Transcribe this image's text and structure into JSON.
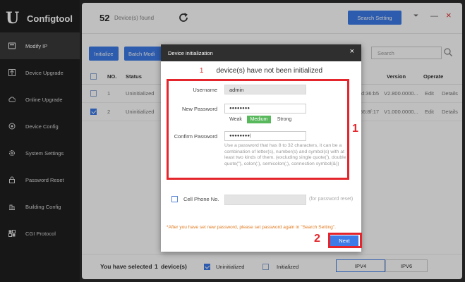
{
  "app": {
    "name": "Configtool",
    "logo_glyph": "U",
    "accent_color": "#3d7be8"
  },
  "sidebar": {
    "items": [
      {
        "label": "Modify IP",
        "icon": "modify-ip-icon",
        "active": true
      },
      {
        "label": "Device Upgrade",
        "icon": "upgrade-icon"
      },
      {
        "label": "Online Upgrade",
        "icon": "cloud-icon"
      },
      {
        "label": "Device Config",
        "icon": "config-icon"
      },
      {
        "label": "System Settings",
        "icon": "gear-icon"
      },
      {
        "label": "Password Reset",
        "icon": "lock-icon"
      },
      {
        "label": "Building Config",
        "icon": "building-icon"
      },
      {
        "label": "CGI Protocol",
        "icon": "protocol-icon"
      }
    ]
  },
  "header": {
    "count": "52",
    "count_label": "Device(s) found",
    "search_setting": "Search Setting",
    "minimize": "—",
    "close": "×",
    "pin": "⏷"
  },
  "toolbar": {
    "initialize": "Initialize",
    "batch_modify": "Batch Modi",
    "search_placeholder": "Search"
  },
  "table": {
    "headers": {
      "no": "NO.",
      "status": "Status",
      "version": "Version",
      "operate": "Operate"
    },
    "rows": [
      {
        "no": "1",
        "status": "Uninitialized",
        "mac_tail": "d:36:b5",
        "version": "V2.800.0000...",
        "edit": "Edit",
        "details": "Details",
        "checked": false
      },
      {
        "no": "2",
        "status": "Uninitialized",
        "mac_tail": "56:8f:17",
        "version": "V1.000.0000...",
        "edit": "Edit",
        "details": "Details",
        "checked": true
      }
    ]
  },
  "footer": {
    "selected_prefix": "You have selected",
    "selected_count": "1",
    "selected_suffix": "device(s)",
    "uninitialized": "Uninitialized",
    "initialized": "Initialized",
    "ipv4": "IPV4",
    "ipv6": "IPV6"
  },
  "dialog": {
    "title": "Device initialization",
    "close": "×",
    "uninit_count": "1",
    "uninit_text": "device(s) have not been initialized",
    "username_label": "Username",
    "username_value": "admin",
    "new_password_label": "New Password",
    "new_password_value": "●●●●●●●●",
    "strength": {
      "weak": "Weak",
      "medium": "Medium",
      "strong": "Strong"
    },
    "confirm_password_label": "Confirm Password",
    "confirm_password_value": "●●●●●●●●|",
    "hint": "Use a password that has 8 to 32 characters, it can be a combination of letter(s), number(s) and symbol(s) with at least two kinds of them. (excluding single quote('), double quote(\"), colon(:), semicolon(;), connection symbol(&))",
    "phone_label": "Cell Phone No.",
    "phone_hint": "(for password reset)",
    "warning": "*After you have set new password, please set password again in \"Search Setting\".",
    "next": "Next"
  },
  "annotations": {
    "label_1": "1",
    "label_2": "2",
    "color": "#e4262c"
  }
}
